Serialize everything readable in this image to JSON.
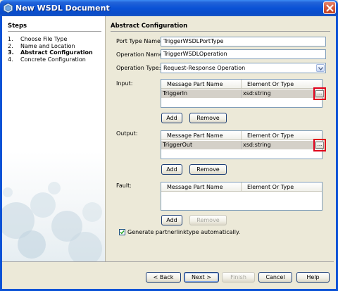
{
  "window": {
    "title": "New WSDL Document",
    "app_icon": "netbeans-icon",
    "close_icon": "close-icon"
  },
  "steps": {
    "title": "Steps",
    "items": [
      {
        "num": "1.",
        "label": "Choose File Type"
      },
      {
        "num": "2.",
        "label": "Name and Location"
      },
      {
        "num": "3.",
        "label": "Abstract Configuration"
      },
      {
        "num": "4.",
        "label": "Concrete Configuration"
      }
    ],
    "current_index": 2
  },
  "content": {
    "title": "Abstract Configuration",
    "port_type_label": "Port Type Name:",
    "port_type_value": "TriggerWSDLPortType",
    "operation_name_label": "Operation Name:",
    "operation_name_value": "TriggerWSDLOperation",
    "operation_type_label": "Operation Type:",
    "operation_type_value": "Request-Response Operation",
    "input": {
      "label": "Input:",
      "columns": [
        "Message Part Name",
        "Element Or Type"
      ],
      "rows": [
        {
          "name": "TriggerIn",
          "type": "xsd:string",
          "browse": "..."
        }
      ],
      "add_label": "Add",
      "remove_label": "Remove"
    },
    "output": {
      "label": "Output:",
      "columns": [
        "Message Part Name",
        "Element Or Type"
      ],
      "rows": [
        {
          "name": "TriggerOut",
          "type": "xsd:string",
          "browse": "..."
        }
      ],
      "add_label": "Add",
      "remove_label": "Remove"
    },
    "fault": {
      "label": "Fault:",
      "columns": [
        "Message Part Name",
        "Element Or Type"
      ],
      "rows": [],
      "add_label": "Add",
      "remove_label": "Remove"
    },
    "partnerlink_checkbox": {
      "label": "Generate partnerlinktype automatically.",
      "checked": true
    }
  },
  "buttons": {
    "back": "< Back",
    "next": "Next >",
    "finish": "Finish",
    "cancel": "Cancel",
    "help": "Help"
  },
  "colors": {
    "titlebar": "#0a52d6",
    "highlight": "#e0001b",
    "row_selected": "#d4d0c8"
  }
}
